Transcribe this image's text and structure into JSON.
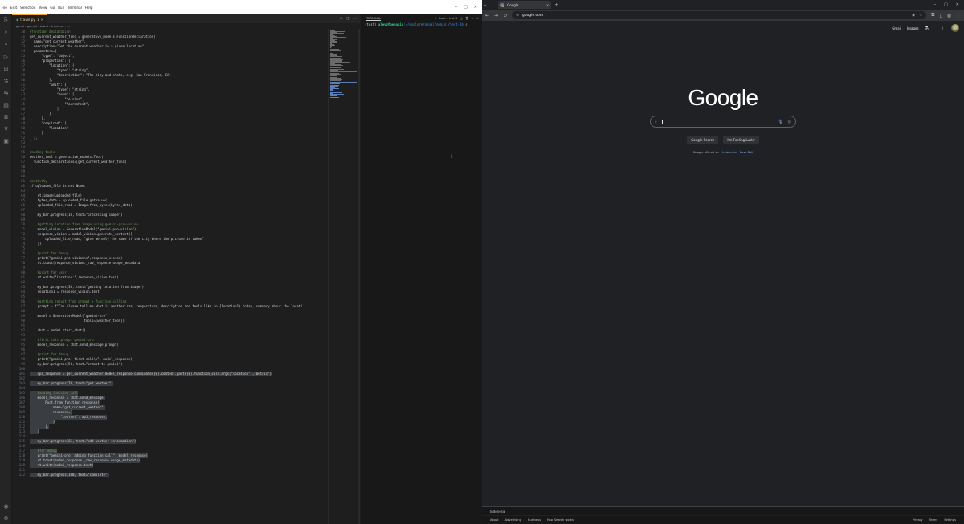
{
  "vscode": {
    "menus": [
      "File",
      "Edit",
      "Selection",
      "View",
      "Go",
      "Run",
      "Terminal",
      "Help"
    ],
    "tab": {
      "name": "travel.py",
      "modified": "1"
    },
    "breadcrumb": "genai › gemini › test-1 › travel.py › ...",
    "terminal": {
      "label": "TERMINAL",
      "tab": "bash - test-1",
      "prompt_env": "(test)",
      "prompt_user": "alevz@penguin",
      "prompt_path": ":~/explore/genai/gemini/test-1$"
    },
    "lines": [
      {
        "n": "30",
        "t": "#function declaration",
        "c": "cmt"
      },
      {
        "n": "31",
        "t": "get_current_weather_func = generative_models.FunctionDeclaration(",
        "c": ""
      },
      {
        "n": "32",
        "t": "  name=\"get_current_weather\",",
        "c": ""
      },
      {
        "n": "33",
        "t": "  description=\"Get the current weather in a given location\",",
        "c": ""
      },
      {
        "n": "34",
        "t": "  parameters={",
        "c": ""
      },
      {
        "n": "35",
        "t": "      \"type\": \"object\",",
        "c": ""
      },
      {
        "n": "36",
        "t": "      \"properties\": {",
        "c": ""
      },
      {
        "n": "37",
        "t": "          \"location\": {",
        "c": ""
      },
      {
        "n": "38",
        "t": "              \"type\": \"string\",",
        "c": ""
      },
      {
        "n": "39",
        "t": "              \"description\": \"The city and state, e.g. San Francisco, CA\"",
        "c": ""
      },
      {
        "n": "40",
        "t": "          },",
        "c": ""
      },
      {
        "n": "41",
        "t": "          \"unit\": {",
        "c": ""
      },
      {
        "n": "42",
        "t": "              \"type\": \"string\",",
        "c": ""
      },
      {
        "n": "43",
        "t": "              \"enum\": [",
        "c": ""
      },
      {
        "n": "44",
        "t": "                  \"celsius\",",
        "c": ""
      },
      {
        "n": "45",
        "t": "                  \"fahrenheit\",",
        "c": ""
      },
      {
        "n": "46",
        "t": "              ]",
        "c": ""
      },
      {
        "n": "47",
        "t": "          }",
        "c": ""
      },
      {
        "n": "48",
        "t": "      },",
        "c": ""
      },
      {
        "n": "49",
        "t": "      \"required\": [",
        "c": ""
      },
      {
        "n": "50",
        "t": "          \"location\"",
        "c": ""
      },
      {
        "n": "51",
        "t": "      ]",
        "c": ""
      },
      {
        "n": "52",
        "t": "  },",
        "c": ""
      },
      {
        "n": "53",
        "t": ")",
        "c": ""
      },
      {
        "n": "54",
        "t": "",
        "c": ""
      },
      {
        "n": "55",
        "t": "#adding tools",
        "c": "cmt"
      },
      {
        "n": "56",
        "t": "weather_tool = generative_models.Tool(",
        "c": ""
      },
      {
        "n": "57",
        "t": "  function_declarations=[get_current_weather_func]",
        "c": ""
      },
      {
        "n": "58",
        "t": ")",
        "c": ""
      },
      {
        "n": "59",
        "t": "",
        "c": ""
      },
      {
        "n": "60",
        "t": "",
        "c": ""
      },
      {
        "n": "61",
        "t": "#activity",
        "c": "cmt"
      },
      {
        "n": "62",
        "t": "if uploaded_file is not None:",
        "c": ""
      },
      {
        "n": "63",
        "t": "",
        "c": ""
      },
      {
        "n": "64",
        "t": "    st.image(uploaded_file)",
        "c": ""
      },
      {
        "n": "65",
        "t": "    bytes_data = uploaded_file.getvalue()",
        "c": ""
      },
      {
        "n": "66",
        "t": "    uploaded_file_read = Image.from_bytes(bytes_data)",
        "c": ""
      },
      {
        "n": "67",
        "t": "",
        "c": ""
      },
      {
        "n": "68",
        "t": "    my_bar.progress(10, text=\"processing image\")",
        "c": ""
      },
      {
        "n": "69",
        "t": "",
        "c": ""
      },
      {
        "n": "70",
        "t": "    #getting location from image using gemini-pro-vision",
        "c": "cmt"
      },
      {
        "n": "71",
        "t": "    model_vision = GenerativeModel(\"gemini-pro-vision\")",
        "c": ""
      },
      {
        "n": "72",
        "t": "    response_vision = model_vision.generate_content([",
        "c": ""
      },
      {
        "n": "73",
        "t": "        uploaded_file_read, \"give me only the name of the city where the picture is taken\"",
        "c": ""
      },
      {
        "n": "74",
        "t": "    ])",
        "c": ""
      },
      {
        "n": "75",
        "t": "",
        "c": ""
      },
      {
        "n": "76",
        "t": "    #print for debug",
        "c": "cmt"
      },
      {
        "n": "77",
        "t": "    print(\"gemini-pro-vision\\n\",response_vision)",
        "c": ""
      },
      {
        "n": "78",
        "t": "    st.toast(response_vision._raw_response.usage_metadata)",
        "c": ""
      },
      {
        "n": "79",
        "t": "",
        "c": ""
      },
      {
        "n": "80",
        "t": "    #print for user",
        "c": "cmt"
      },
      {
        "n": "81",
        "t": "    st.write(\"Location:\",response_vision.text)",
        "c": ""
      },
      {
        "n": "82",
        "t": "",
        "c": ""
      },
      {
        "n": "83",
        "t": "    my_bar.progress(30, text=\"getting location from image\")",
        "c": ""
      },
      {
        "n": "84",
        "t": "    location1 = response_vision.text",
        "c": ""
      },
      {
        "n": "85",
        "t": "",
        "c": ""
      },
      {
        "n": "86",
        "t": "    #getting result from prompt + function calling",
        "c": "cmt"
      },
      {
        "n": "87",
        "t": "    prompt = f\"Can please tell me what is weather real temperature, description and feels like in {location1} today, summary about the locati",
        "c": ""
      },
      {
        "n": "88",
        "t": "",
        "c": ""
      },
      {
        "n": "89",
        "t": "    model = GenerativeModel(\"gemini-pro\",",
        "c": ""
      },
      {
        "n": "90",
        "t": "                            tools=[weather_tool])",
        "c": ""
      },
      {
        "n": "91",
        "t": "",
        "c": ""
      },
      {
        "n": "92",
        "t": "    chat = model.start_chat()",
        "c": ""
      },
      {
        "n": "93",
        "t": "",
        "c": ""
      },
      {
        "n": "94",
        "t": "    #first init prompt gemini-pro",
        "c": "cmt"
      },
      {
        "n": "95",
        "t": "    model_response = chat.send_message(prompt)",
        "c": ""
      },
      {
        "n": "96",
        "t": "",
        "c": ""
      },
      {
        "n": "97",
        "t": "    #print for debug",
        "c": "cmt"
      },
      {
        "n": "98",
        "t": "    print(\"gemini-pro: first call\\n\", model_response)",
        "c": ""
      },
      {
        "n": "99",
        "t": "    my_bar.progress(50, text=\"prompt to gemini\")",
        "c": ""
      },
      {
        "n": "100",
        "t": "",
        "c": ""
      },
      {
        "n": "101",
        "t": "    api_response = get_current_weather(model_response.candidates[0].content.parts[0].function_call.args[\"location\"],\"metric\")",
        "c": "sel"
      },
      {
        "n": "102",
        "t": "",
        "c": ""
      },
      {
        "n": "103",
        "t": "    my_bar.progress(70, text=\"get weather\")",
        "c": "sel"
      },
      {
        "n": "104",
        "t": "",
        "c": ""
      },
      {
        "n": "105",
        "t": "    #adding function call",
        "c": "sel cmt"
      },
      {
        "n": "106",
        "t": "    model_response = chat.send_message(",
        "c": "sel"
      },
      {
        "n": "107",
        "t": "        Part.from_function_response(",
        "c": "sel"
      },
      {
        "n": "108",
        "t": "            name=\"get_current_weather\",",
        "c": "sel"
      },
      {
        "n": "109",
        "t": "            response={",
        "c": "sel"
      },
      {
        "n": "110",
        "t": "                \"content\": api_response,",
        "c": "sel"
      },
      {
        "n": "111",
        "t": "            }",
        "c": "sel"
      },
      {
        "n": "112",
        "t": "        ),",
        "c": "sel"
      },
      {
        "n": "113",
        "t": "    )",
        "c": "sel"
      },
      {
        "n": "114",
        "t": "",
        "c": ""
      },
      {
        "n": "115",
        "t": "    my_bar.progress(85, text=\"add weather information\")",
        "c": "sel"
      },
      {
        "n": "116",
        "t": "",
        "c": ""
      },
      {
        "n": "117",
        "t": "    #for debug",
        "c": "sel cmt"
      },
      {
        "n": "118",
        "t": "    print(\"gemini-pro: adding function call\", model_response)",
        "c": "sel"
      },
      {
        "n": "119",
        "t": "    st.toast(model_response._raw_response.usage_metadata)",
        "c": "sel"
      },
      {
        "n": "120",
        "t": "    st.write(model_response.text)",
        "c": "sel"
      },
      {
        "n": "121",
        "t": "",
        "c": ""
      },
      {
        "n": "122",
        "t": "    my_bar.progress(100, text=\"complete\")",
        "c": "sel"
      }
    ]
  },
  "chrome": {
    "tab_title": "Google",
    "url": "google.com",
    "topbar": {
      "gmail": "Gmail",
      "images": "Images"
    },
    "logo": "Google",
    "buttons": {
      "search": "Google Search",
      "lucky": "I'm Feeling Lucky"
    },
    "offered": {
      "prefix": "Google offered in:",
      "lang1": "Indonesia",
      "lang2": "Basa Bali"
    },
    "footer": {
      "country": "Indonesia",
      "left": [
        "About",
        "Advertising",
        "Business",
        "How Search works"
      ],
      "right": [
        "Privacy",
        "Terms",
        "Settings"
      ]
    }
  },
  "colors": {
    "vscode_bg": "#1e1e1e",
    "chrome_bg": "#202124",
    "selection": "#3a3d41",
    "link": "#8ab4f8"
  }
}
